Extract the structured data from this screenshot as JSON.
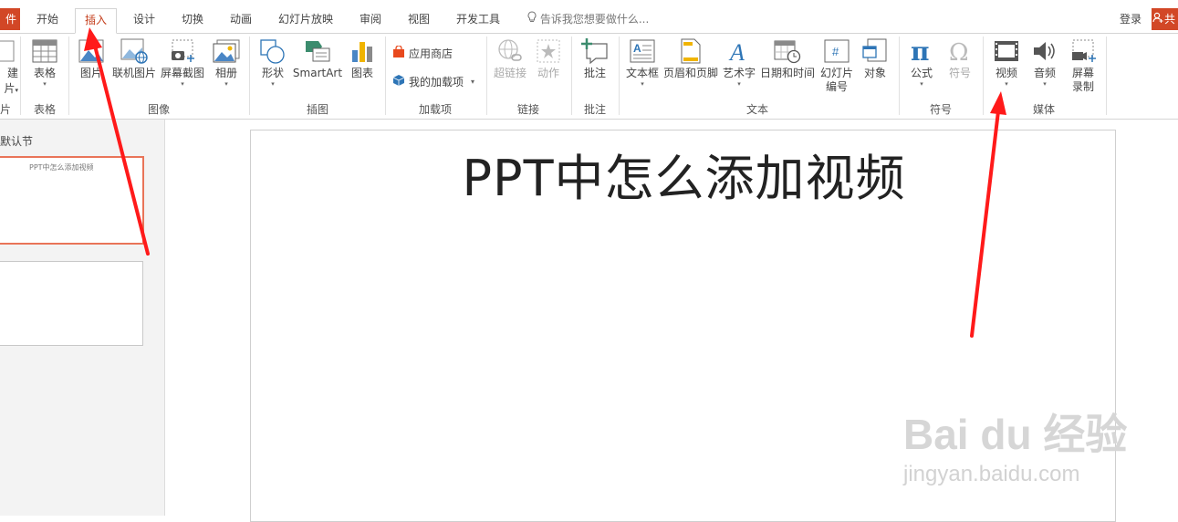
{
  "tabs": {
    "file": "件",
    "items": [
      "开始",
      "插入",
      "设计",
      "切换",
      "动画",
      "幻灯片放映",
      "审阅",
      "视图",
      "开发工具"
    ],
    "active": "插入",
    "tell_me": "告诉我您想要做什么...",
    "login": "登录",
    "share": "共"
  },
  "ribbon": {
    "new_slide": {
      "line1": "建",
      "line2": "片"
    },
    "new_slide_group": "片",
    "table": {
      "label": "表格",
      "group": "表格"
    },
    "images": {
      "group": "图像",
      "picture": "图片",
      "online_picture": "联机图片",
      "screenshot": "屏幕截图",
      "album": "相册"
    },
    "illustrations": {
      "group": "插图",
      "shapes": "形状",
      "smartart": "SmartArt",
      "chart": "图表"
    },
    "addins": {
      "group": "加载项",
      "store": "应用商店",
      "my_addins": "我的加载项"
    },
    "links": {
      "group": "链接",
      "hyperlink": "超链接",
      "action": "动作"
    },
    "comments": {
      "group": "批注",
      "comment": "批注"
    },
    "text": {
      "group": "文本",
      "textbox": "文本框",
      "header_footer": "页眉和页脚",
      "wordart": "艺术字",
      "datetime": "日期和时间",
      "slide_number_1": "幻灯片",
      "slide_number_2": "编号",
      "object": "对象"
    },
    "symbols": {
      "group": "符号",
      "equation": "公式",
      "symbol": "符号"
    },
    "media": {
      "group": "媒体",
      "video": "视频",
      "audio": "音频",
      "record_1": "屏幕",
      "record_2": "录制"
    }
  },
  "left_panel": {
    "section": "默认节",
    "thumb1_title": "PPT中怎么添加视频"
  },
  "slide": {
    "title": "PPT中怎么添加视频"
  },
  "watermark": {
    "logo": "Bai du 经验",
    "url": "jingyan.baidu.com"
  },
  "colors": {
    "accent": "#d24726",
    "active_tab_text": "#c43e1c",
    "thumb_border": "#e97458",
    "arrow": "#ff1a1a"
  }
}
